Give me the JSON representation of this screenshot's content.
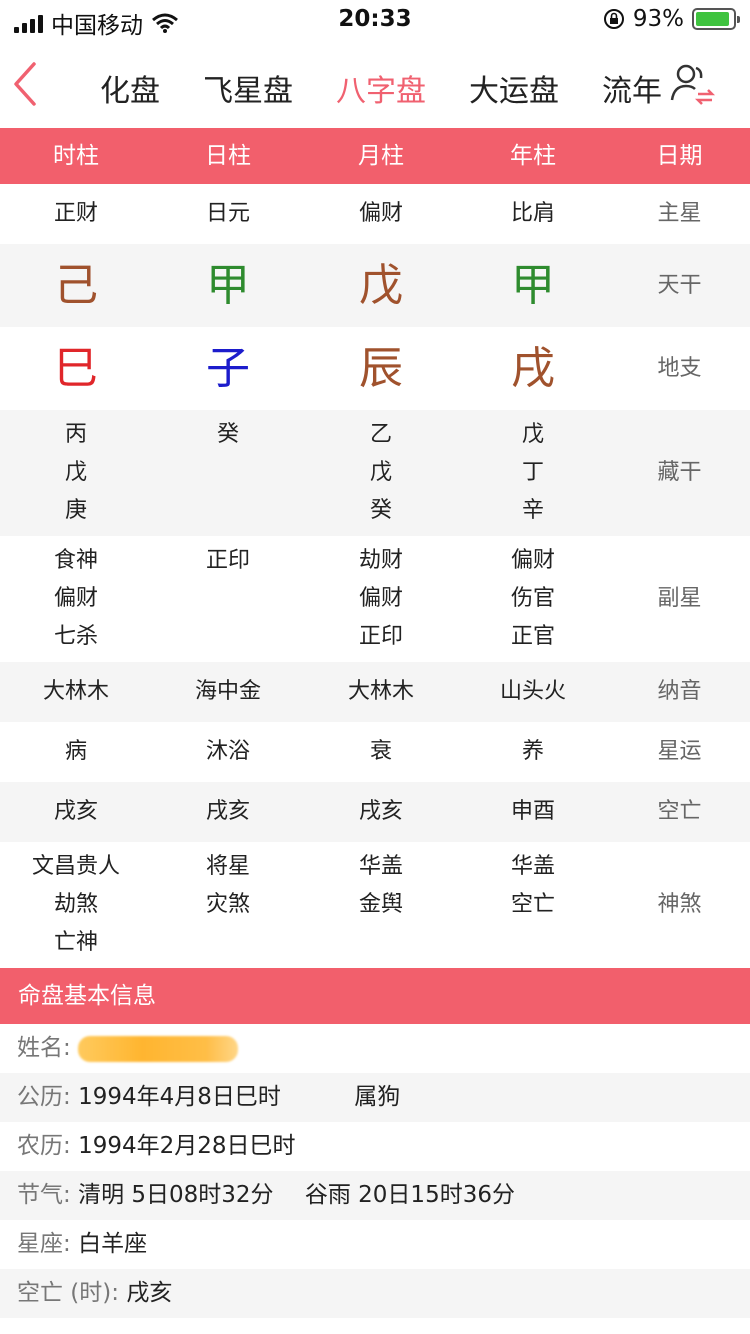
{
  "status": {
    "carrier": "中国移动",
    "time": "20:33",
    "battery": "93%",
    "battery_level": 0.93
  },
  "nav": {
    "tabs": [
      "化盘",
      "飞星盘",
      "八字盘",
      "大运盘",
      "流年"
    ],
    "active_index": 2,
    "accent_color": "#f06170"
  },
  "table": {
    "headers": [
      "时柱",
      "日柱",
      "月柱",
      "年柱",
      "日期"
    ],
    "main_star": {
      "label": "主星",
      "values": [
        "正财",
        "日元",
        "偏财",
        "比肩"
      ]
    },
    "heavenly_stem": {
      "label": "天干",
      "values": [
        "己",
        "甲",
        "戊",
        "甲"
      ]
    },
    "earthly_branch": {
      "label": "地支",
      "values": [
        "巳",
        "子",
        "辰",
        "戌"
      ]
    },
    "hidden_stems": {
      "label": "藏干",
      "values": [
        [
          "丙",
          "戊",
          "庚"
        ],
        [
          "癸"
        ],
        [
          "乙",
          "戊",
          "癸"
        ],
        [
          "戊",
          "丁",
          "辛"
        ]
      ]
    },
    "sub_star": {
      "label": "副星",
      "values": [
        [
          "食神",
          "偏财",
          "七杀"
        ],
        [
          "正印"
        ],
        [
          "劫财",
          "偏财",
          "正印"
        ],
        [
          "偏财",
          "伤官",
          "正官"
        ]
      ]
    },
    "nayin": {
      "label": "纳音",
      "values": [
        "大林木",
        "海中金",
        "大林木",
        "山头火"
      ]
    },
    "star_fortune": {
      "label": "星运",
      "values": [
        "病",
        "沐浴",
        "衰",
        "养"
      ]
    },
    "void": {
      "label": "空亡",
      "values": [
        "戌亥",
        "戌亥",
        "戌亥",
        "申酉"
      ]
    },
    "shensha": {
      "label": "神煞",
      "values": [
        [
          "文昌贵人",
          "劫煞",
          "亡神"
        ],
        [
          "将星",
          "灾煞"
        ],
        [
          "华盖",
          "金舆"
        ],
        [
          "华盖",
          "空亡"
        ]
      ]
    }
  },
  "info": {
    "header": "命盘基本信息",
    "name_label": "姓名:",
    "solar_label": "公历:",
    "solar_value": "1994年4月8日巳时",
    "zodiac": "属狗",
    "lunar_label": "农历:",
    "lunar_value": "1994年2月28日巳时",
    "solar_term_label": "节气:",
    "solar_term_value": "清明 5日08时32分",
    "solar_term_value2": "谷雨 20日15时36分",
    "constellation_label": "星座:",
    "constellation_value": "白羊座",
    "void_hour_label": "空亡 (时):",
    "void_hour_value": "戌亥"
  }
}
